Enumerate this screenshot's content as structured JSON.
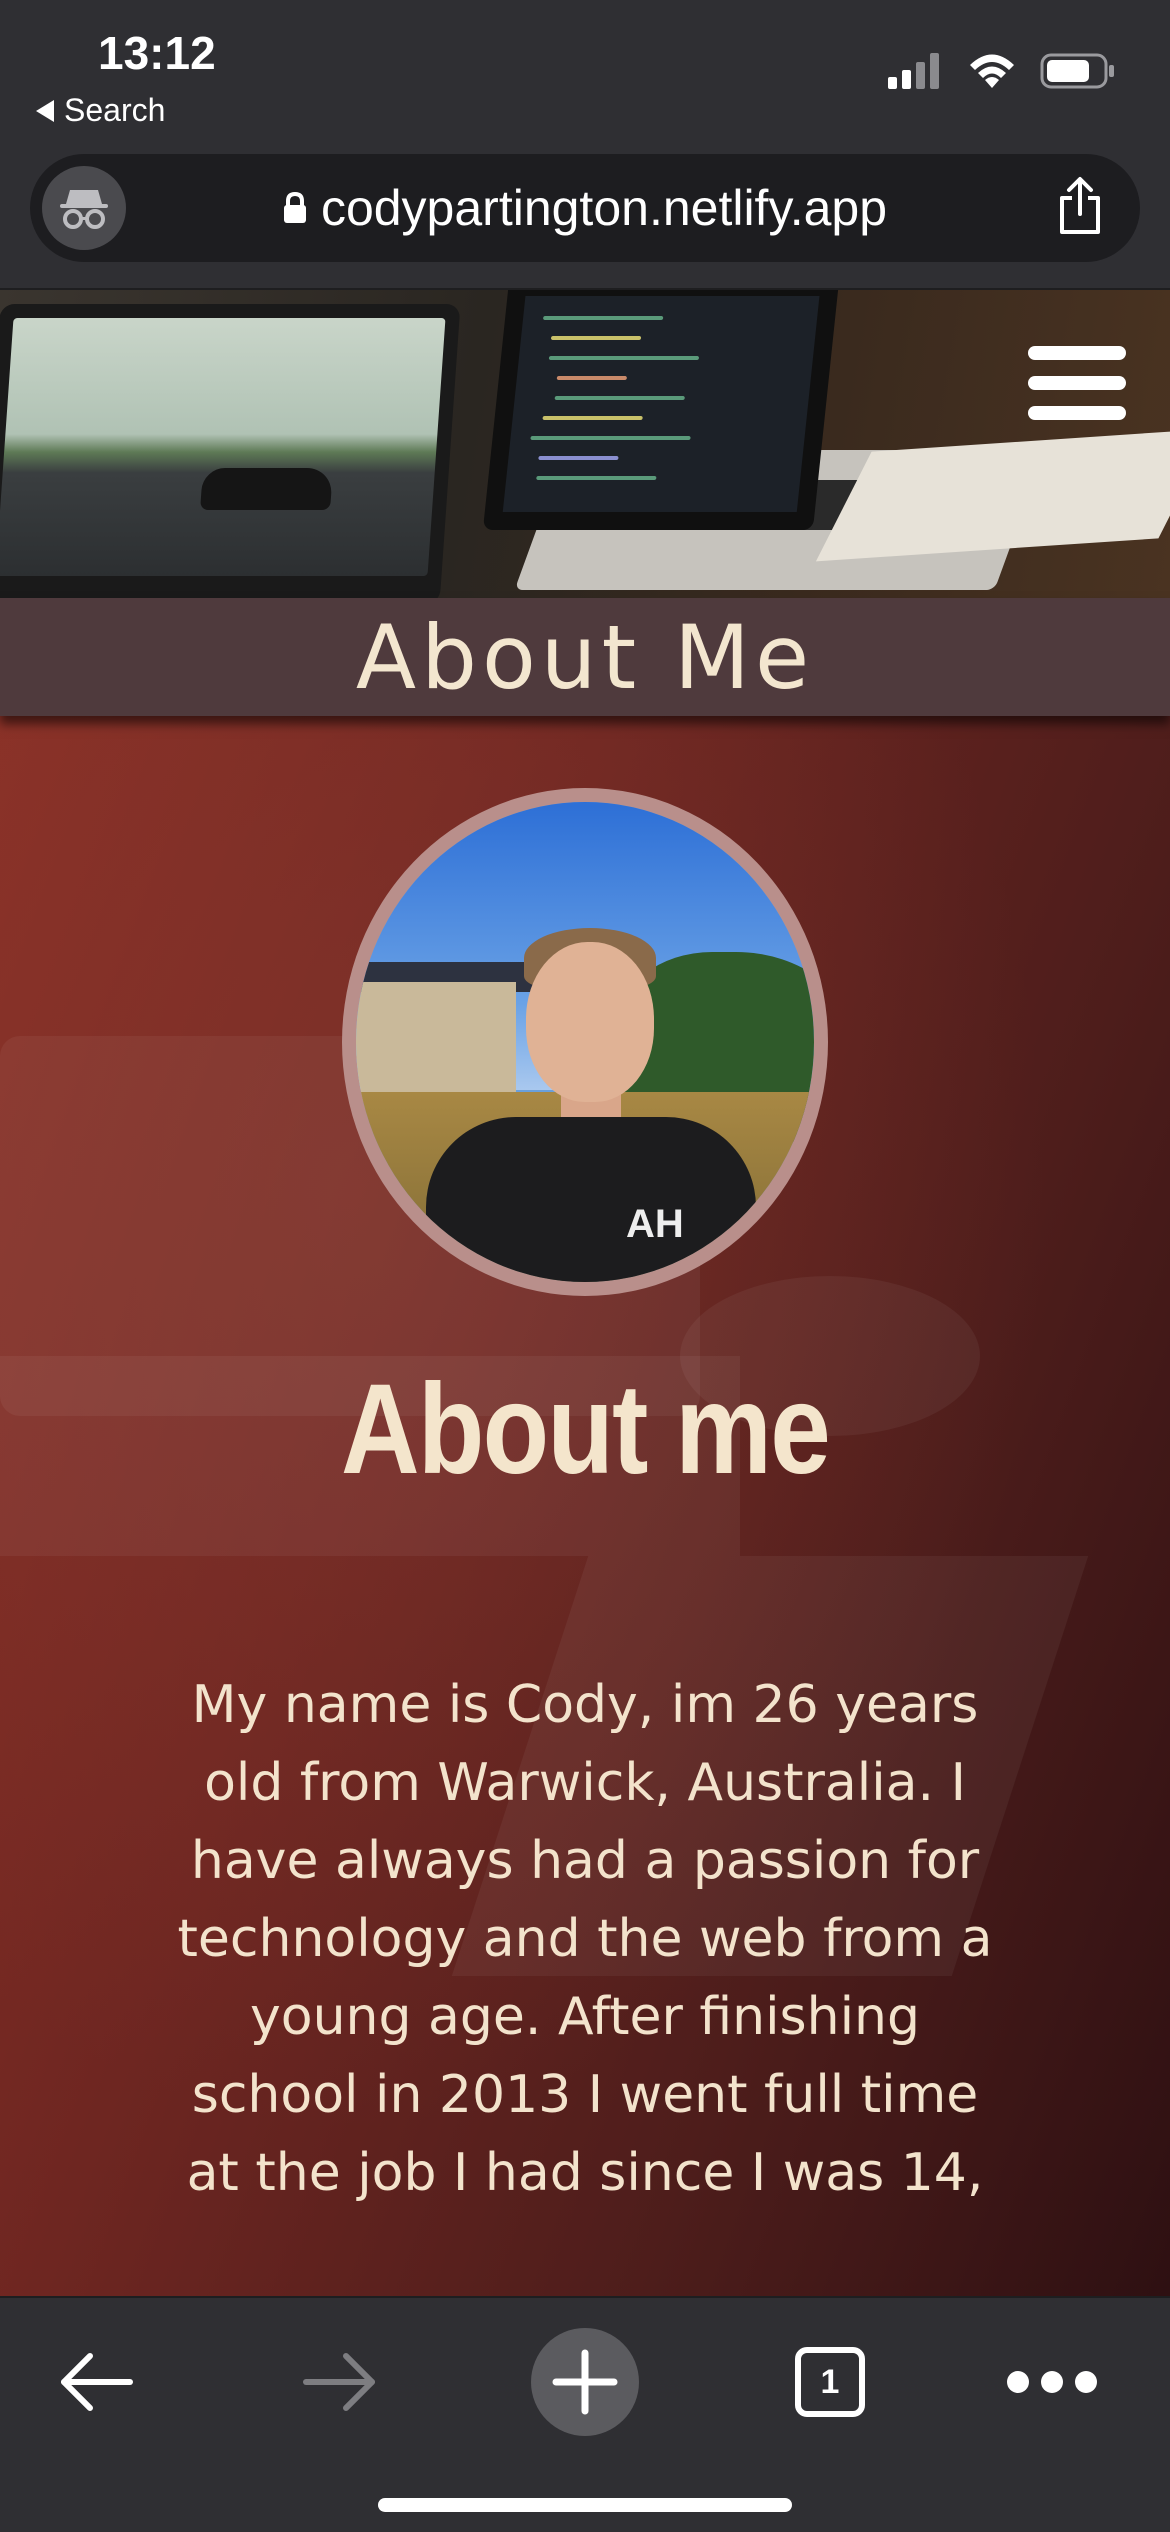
{
  "status_bar": {
    "time": "13:12",
    "back_app_label": "Search",
    "icons": [
      "cellular-signal-icon",
      "wifi-icon",
      "battery-icon"
    ]
  },
  "browser": {
    "url": "codypartington.netlify.app",
    "icons": [
      "incognito-icon",
      "lock-icon",
      "share-icon"
    ]
  },
  "page": {
    "section_title": "About Me",
    "menu_icon": "hamburger-menu-icon",
    "about_heading": "About me",
    "about_text": "My name is Cody, im 26 years old from Warwick, Australia. I have always had a passion for technology and the web from a young age. After finishing school in 2013 I went full time at the job I had since I was 14,",
    "shirt_logo": "AH"
  },
  "toolbar": {
    "tab_count": "1",
    "icons": [
      "back-arrow-icon",
      "forward-arrow-icon",
      "new-tab-plus-icon",
      "tabs-icon",
      "more-icon"
    ]
  },
  "colors": {
    "section_bar": "#4f3a3d",
    "heading_text": "#f4e5cc",
    "content_bg": "#6e2621",
    "avatar_border": "#b98f8b",
    "chrome": "#2f2f33"
  }
}
